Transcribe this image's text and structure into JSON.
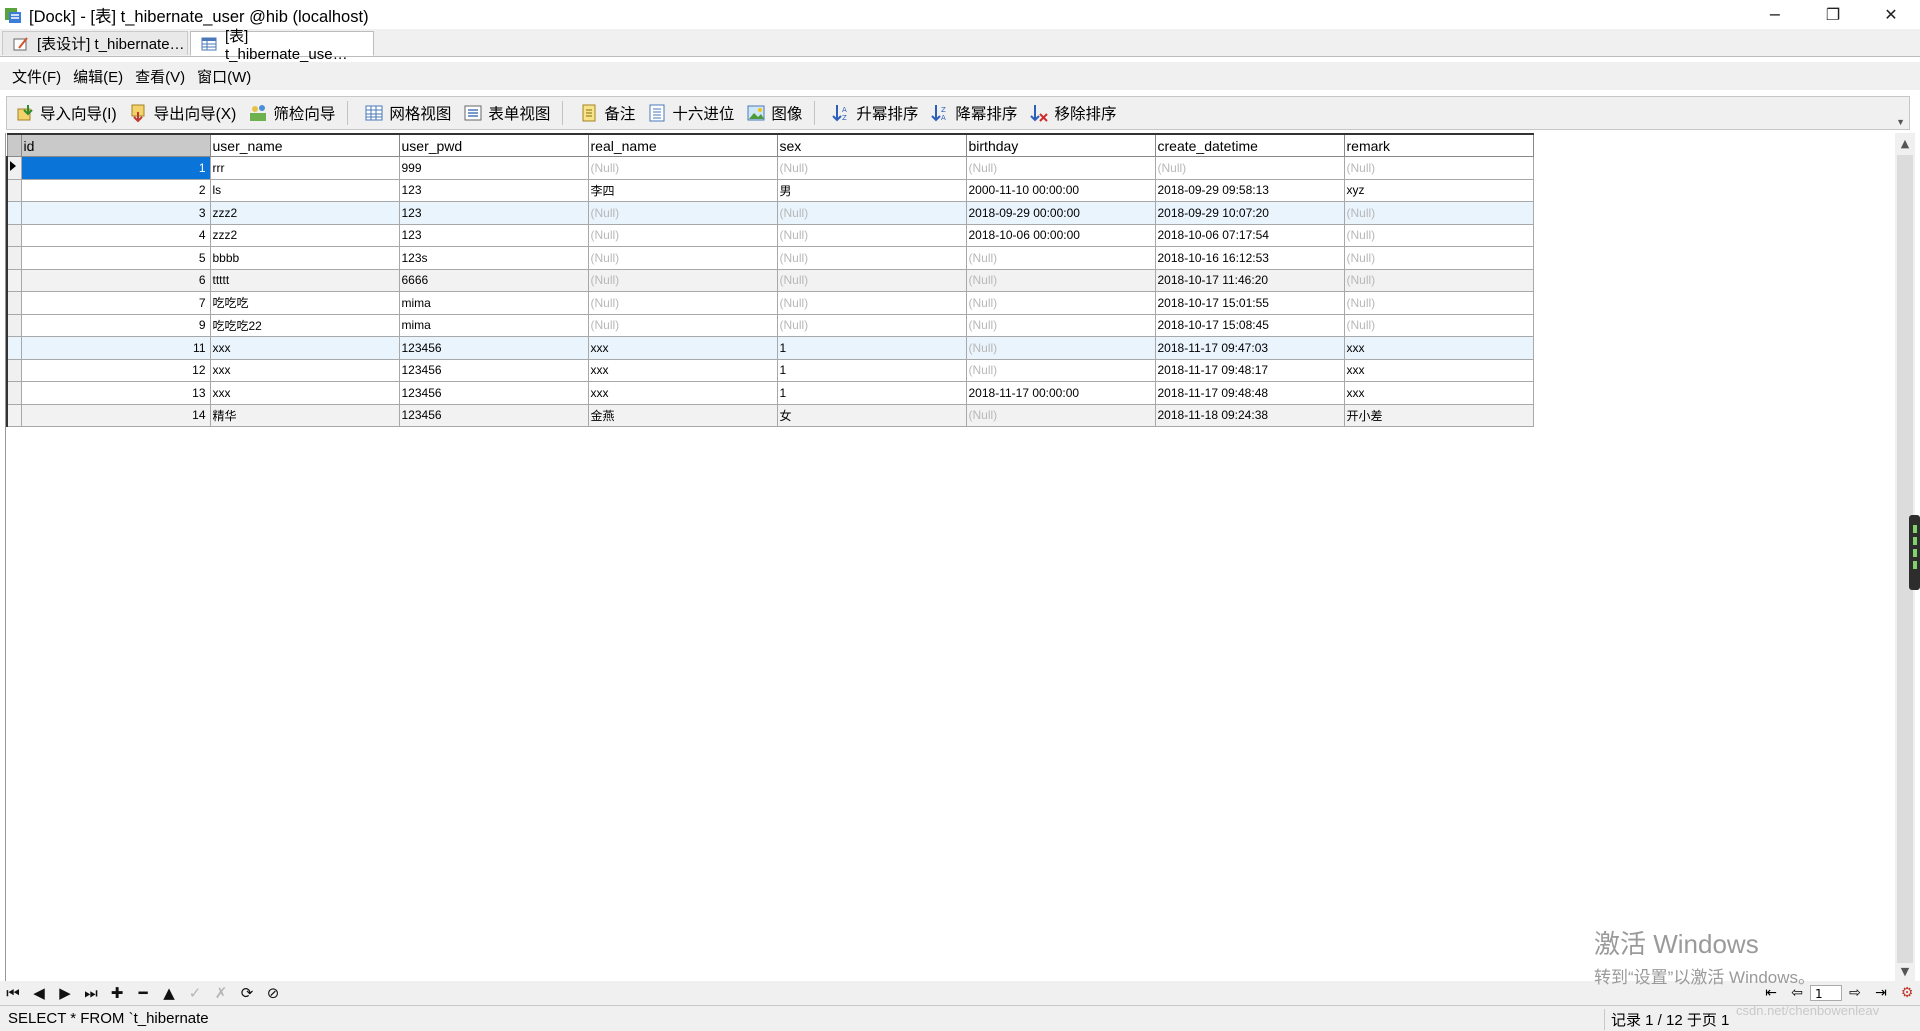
{
  "window": {
    "title": "[Dock] - [表] t_hibernate_user @hib (localhost)",
    "min": "−",
    "restore": "❐",
    "close": "✕"
  },
  "tabs": [
    {
      "label": "[表设计] t_hibernate…",
      "active": false
    },
    {
      "label": "[表] t_hibernate_use…",
      "active": true
    }
  ],
  "menu": [
    "文件(F)",
    "编辑(E)",
    "查看(V)",
    "窗口(W)"
  ],
  "toolbar": {
    "import": "导入向导(I)",
    "export": "导出向导(X)",
    "filter": "筛检向导",
    "grid_view": "网格视图",
    "form_view": "表单视图",
    "memo": "备注",
    "hex": "十六进位",
    "image": "图像",
    "sort_asc": "升幂排序",
    "sort_desc": "降幂排序",
    "sort_remove": "移除排序"
  },
  "grid": {
    "columns": [
      "id",
      "user_name",
      "user_pwd",
      "real_name",
      "sex",
      "birthday",
      "create_datetime",
      "remark"
    ],
    "null_text": "(Null)",
    "rows": [
      [
        "1",
        "rrr",
        "999",
        "(Null)",
        "(Null)",
        "(Null)",
        "(Null)",
        "(Null)"
      ],
      [
        "2",
        "ls",
        "123",
        "李四",
        "男",
        "2000-11-10 00:00:00",
        "2018-09-29 09:58:13",
        "xyz"
      ],
      [
        "3",
        "zzz2",
        "123",
        "(Null)",
        "(Null)",
        "2018-09-29 00:00:00",
        "2018-09-29 10:07:20",
        "(Null)"
      ],
      [
        "4",
        "zzz2",
        "123",
        "(Null)",
        "(Null)",
        "2018-10-06 00:00:00",
        "2018-10-06 07:17:54",
        "(Null)"
      ],
      [
        "5",
        "bbbb",
        "123s",
        "(Null)",
        "(Null)",
        "(Null)",
        "2018-10-16 16:12:53",
        "(Null)"
      ],
      [
        "6",
        "ttttt",
        "6666",
        "(Null)",
        "(Null)",
        "(Null)",
        "2018-10-17 11:46:20",
        "(Null)"
      ],
      [
        "7",
        "吃吃吃",
        "mima",
        "(Null)",
        "(Null)",
        "(Null)",
        "2018-10-17 15:01:55",
        "(Null)"
      ],
      [
        "9",
        "吃吃吃22",
        "mima",
        "(Null)",
        "(Null)",
        "(Null)",
        "2018-10-17 15:08:45",
        "(Null)"
      ],
      [
        "11",
        "xxx",
        "123456",
        "xxx",
        "1",
        "(Null)",
        "2018-11-17 09:47:03",
        "xxx"
      ],
      [
        "12",
        "xxx",
        "123456",
        "xxx",
        "1",
        "(Null)",
        "2018-11-17 09:48:17",
        "xxx"
      ],
      [
        "13",
        "xxx",
        "123456",
        "xxx",
        "1",
        "2018-11-17 00:00:00",
        "2018-11-17 09:48:48",
        "xxx"
      ],
      [
        "14",
        "精华",
        "123456",
        "金燕",
        "女",
        "(Null)",
        "2018-11-18 09:24:38",
        "开小差"
      ]
    ]
  },
  "navbar": [
    "⏮",
    "◀",
    "▶",
    "⏭",
    "✚",
    "━",
    "▲",
    "✓",
    "✗",
    "⟳",
    "⊘"
  ],
  "pager": {
    "first": "⇤",
    "prev": "⇦",
    "page": "1",
    "next": "⇨",
    "last": "⇥"
  },
  "status": {
    "sql": "SELECT * FROM `t_hibernate",
    "record": "记录 1 / 12 于页 1"
  },
  "watermark": {
    "line1": "激活 Windows",
    "line2": "转到“设置”以激活 Windows。"
  },
  "blogmark": "csdn.net/chenbowenleav"
}
